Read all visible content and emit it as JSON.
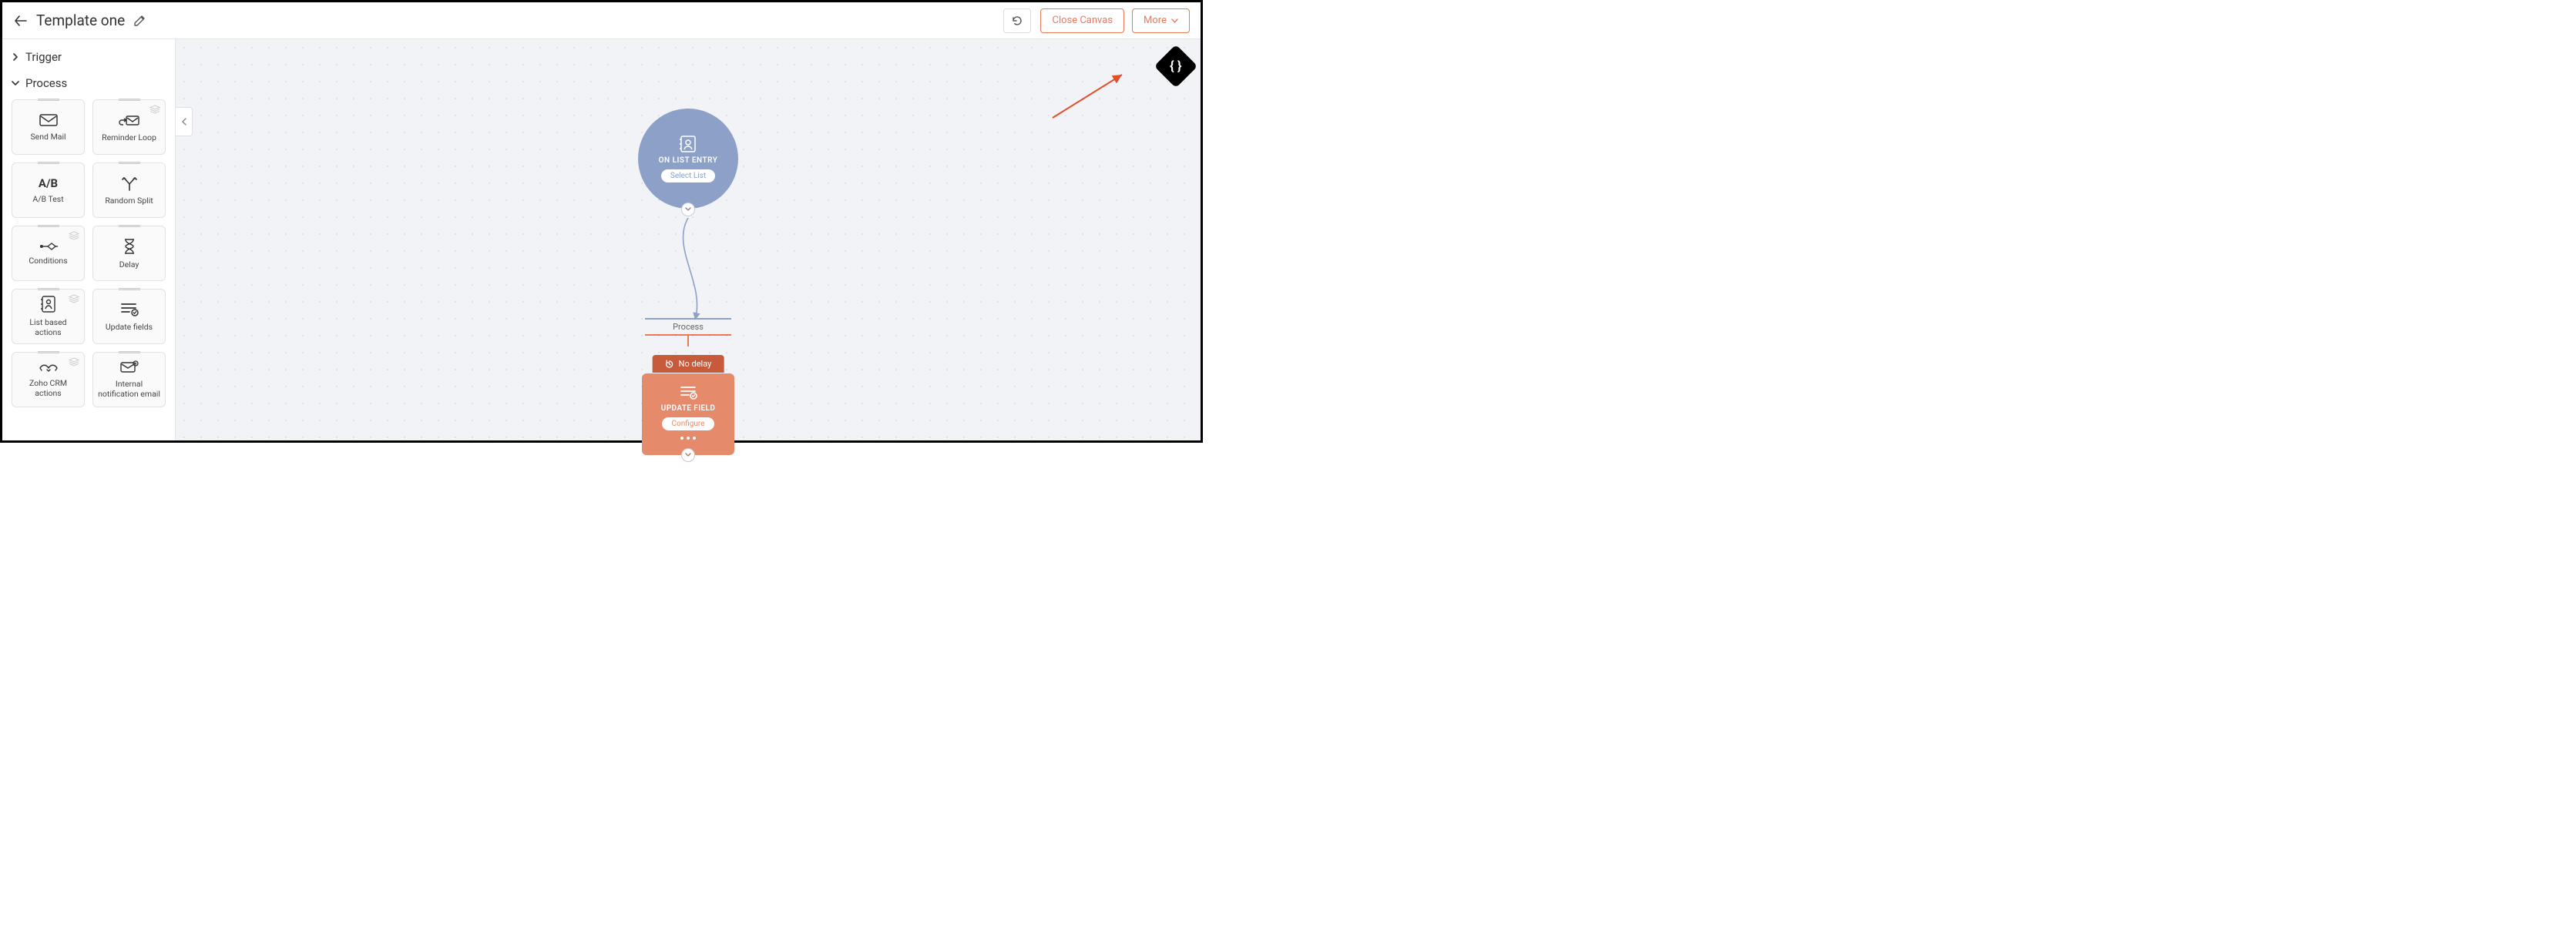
{
  "header": {
    "title": "Template one",
    "close_label": "Close Canvas",
    "more_label": "More"
  },
  "sidebar": {
    "trigger_section": "Trigger",
    "process_section": "Process",
    "tiles": [
      {
        "label": "Send Mail",
        "icon": "mail-icon",
        "stack": false
      },
      {
        "label": "Reminder Loop",
        "icon": "reminder-loop-icon",
        "stack": true
      },
      {
        "label": "A/B Test",
        "icon": "ab-test-icon",
        "stack": false
      },
      {
        "label": "Random Split",
        "icon": "random-split-icon",
        "stack": false
      },
      {
        "label": "Conditions",
        "icon": "conditions-icon",
        "stack": true
      },
      {
        "label": "Delay",
        "icon": "delay-icon",
        "stack": false
      },
      {
        "label": "List based actions",
        "icon": "list-actions-icon",
        "stack": true
      },
      {
        "label": "Update fields",
        "icon": "update-fields-icon",
        "stack": false
      },
      {
        "label": "Zoho CRM actions",
        "icon": "crm-actions-icon",
        "stack": true
      },
      {
        "label": "Internal notification email",
        "icon": "internal-email-icon",
        "stack": false
      }
    ]
  },
  "canvas": {
    "trigger": {
      "title": "ON LIST ENTRY",
      "pill": "Select List"
    },
    "process_label": "Process",
    "delay_label": "No delay",
    "action": {
      "title": "UPDATE FIELD",
      "pill": "Configure"
    },
    "dev_badge": "{ }"
  }
}
